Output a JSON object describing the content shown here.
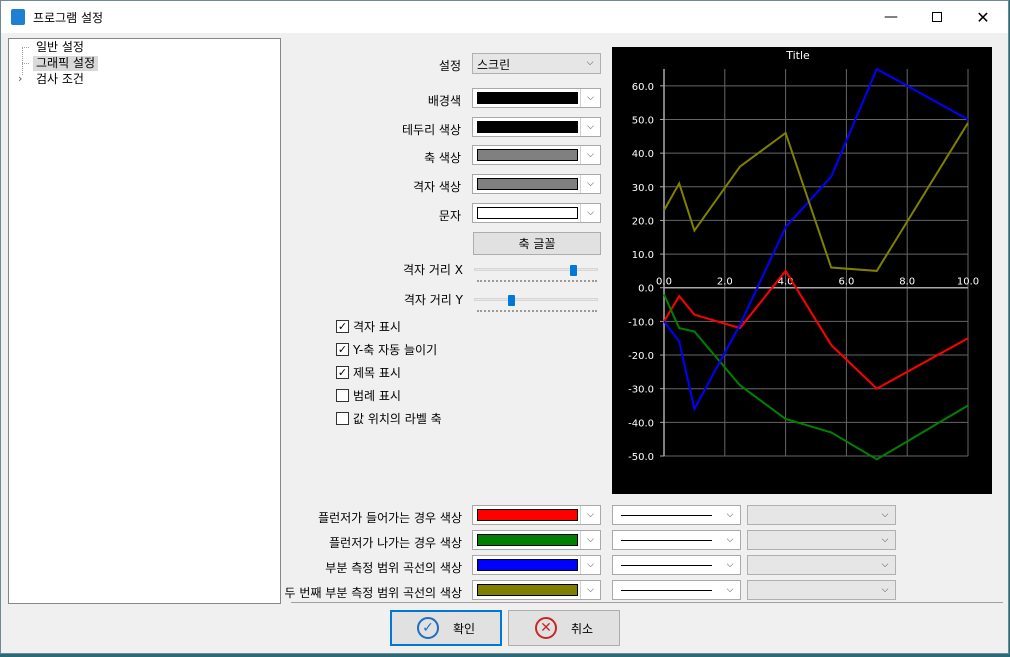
{
  "window": {
    "title": "프로그램 설정",
    "minimize_icon": "minimize-icon",
    "maximize_icon": "maximize-icon",
    "close_icon": "close-icon"
  },
  "tree": {
    "items": [
      {
        "label": "일반 설정",
        "selected": false
      },
      {
        "label": "그래픽 설정",
        "selected": true
      },
      {
        "label": "검사 조건",
        "selected": false,
        "expandable": true
      }
    ]
  },
  "settings": {
    "preset_label": "설정",
    "preset_value": "스크린",
    "background_label": "배경색",
    "background_color": "#000000",
    "border_label": "테두리 색상",
    "border_color": "#000000",
    "axis_label": "축 색상",
    "axis_color": "#808080",
    "grid_label": "격자 색상",
    "grid_color": "#808080",
    "text_label": "문자",
    "text_color": "#ffffff",
    "axis_font_button": "축 글꼴",
    "grid_x_label": "격자 거리 X",
    "grid_x_level": 0.8,
    "grid_y_label": "격자 거리 Y",
    "grid_y_level": 0.3
  },
  "checkboxes": [
    {
      "label": "격자 표시",
      "checked": true
    },
    {
      "label": "Y-축 자동 늘이기",
      "checked": true
    },
    {
      "label": "제목 표시",
      "checked": true
    },
    {
      "label": "범례 표시",
      "checked": false
    },
    {
      "label": "값 위치의 라벨 축",
      "checked": false
    }
  ],
  "series_rows": [
    {
      "label": "플런저가 들어가는 경우 색상",
      "color": "#ff0000"
    },
    {
      "label": "플런저가 나가는 경우 색상",
      "color": "#008000"
    },
    {
      "label": "부분 측정 범위 곡선의 색상",
      "color": "#0000ff"
    },
    {
      "label": "두 번째 부분 측정 범위 곡선의 색상",
      "color": "#808000"
    }
  ],
  "buttons": {
    "ok": "확인",
    "cancel": "취소"
  },
  "chart_data": {
    "type": "line",
    "title": "Title",
    "xlim": [
      0,
      10
    ],
    "ylim": [
      -50,
      65
    ],
    "xticks": [
      "0.0",
      "2.0",
      "4.0",
      "6.0",
      "8.0",
      "10.0"
    ],
    "yticks": [
      "60.0",
      "50.0",
      "40.0",
      "30.0",
      "20.0",
      "10.0",
      "0.0",
      "-10.0",
      "-20.0",
      "-30.0",
      "-40.0",
      "-50.0"
    ],
    "grid": true,
    "series": [
      {
        "color": "#ff0000",
        "x": [
          0,
          0.5,
          1,
          2.5,
          4,
          5.5,
          7,
          10
        ],
        "y": [
          -10,
          -2.5,
          -8,
          -12,
          5,
          -17,
          -30,
          -15
        ]
      },
      {
        "color": "#008000",
        "x": [
          0,
          0.5,
          1,
          2.5,
          4,
          5.5,
          7,
          10
        ],
        "y": [
          -2,
          -12,
          -13,
          -29,
          -39,
          -43,
          -51,
          -35
        ]
      },
      {
        "color": "#0000ff",
        "x": [
          0,
          0.5,
          1,
          2.5,
          4,
          5.5,
          7,
          10
        ],
        "y": [
          -10,
          -16,
          -36,
          -11,
          18,
          33,
          65,
          50
        ]
      },
      {
        "color": "#808000",
        "x": [
          0,
          0.5,
          1,
          2.5,
          4,
          5.5,
          7,
          10
        ],
        "y": [
          23,
          31,
          17,
          36,
          46,
          6,
          5,
          49
        ]
      }
    ]
  }
}
